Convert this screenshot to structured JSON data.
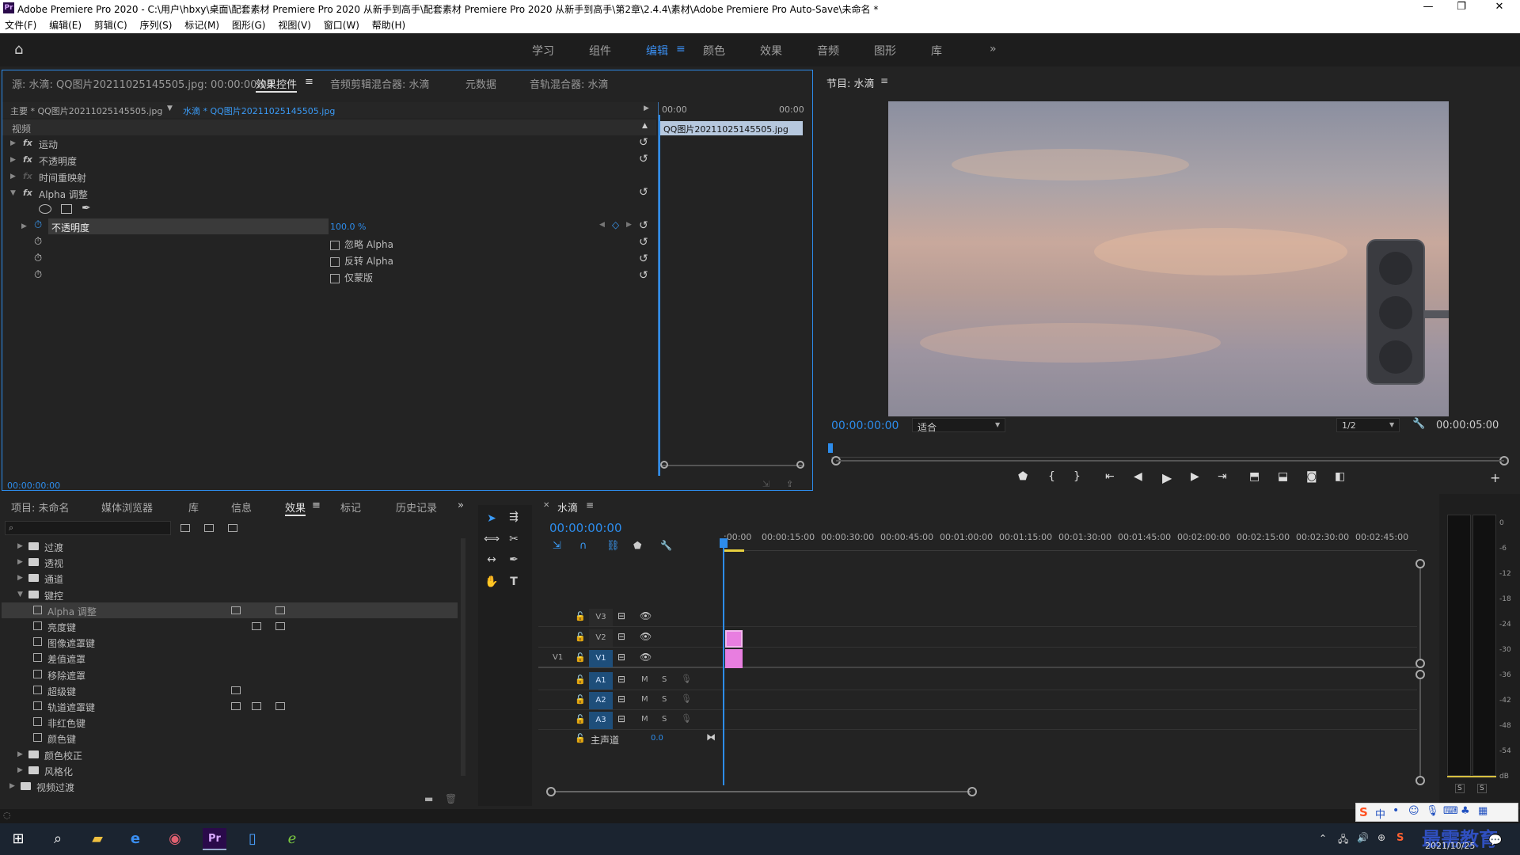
{
  "window": {
    "title": "Adobe Premiere Pro 2020 - C:\\用户\\hbxy\\桌面\\配套素材 Premiere Pro 2020 从新手到高手\\配套素材 Premiere Pro 2020 从新手到高手\\第2章\\2.4.4\\素材\\Adobe Premiere Pro Auto-Save\\未命名 *",
    "app_icon": "Pr",
    "minimize": "—",
    "restore": "❐",
    "close": "✕"
  },
  "menu": [
    "文件(F)",
    "编辑(E)",
    "剪辑(C)",
    "序列(S)",
    "标记(M)",
    "图形(G)",
    "视图(V)",
    "窗口(W)",
    "帮助(H)"
  ],
  "workspaces": {
    "items": [
      "学习",
      "组件",
      "编辑",
      "颜色",
      "效果",
      "音频",
      "图形",
      "库"
    ],
    "active": "编辑",
    "more": "»"
  },
  "effect_controls": {
    "tabs": [
      "源: 水滴: QQ图片20211025145505.jpg: 00:00:00:00",
      "效果控件",
      "音频剪辑混合器: 水滴",
      "元数据",
      "音轨混合器: 水滴"
    ],
    "master_clip": "主要 * QQ图片20211025145505.jpg",
    "seq_clip": "水滴 * QQ图片20211025145505.jpg",
    "mini_start": "00:00",
    "mini_end": "00:00",
    "mini_clip": "QQ图片20211025145505.jpg",
    "section": "视频",
    "fx": [
      {
        "name": "运动"
      },
      {
        "name": "不透明度"
      },
      {
        "name": "时间重映射"
      },
      {
        "name": "Alpha 调整"
      }
    ],
    "opacity_label": "不透明度",
    "opacity_value": "100.0 %",
    "checks": [
      "忽略 Alpha",
      "反转 Alpha",
      "仅蒙版"
    ],
    "timecode": "00:00:00:00"
  },
  "program": {
    "title": "节目: 水滴",
    "timecode": "00:00:00:00",
    "fit": "适合",
    "res": "1/2",
    "duration": "00:00:05:00"
  },
  "project": {
    "tabs": [
      "项目: 未命名",
      "媒体浏览器",
      "库",
      "信息",
      "效果",
      "标记",
      "历史记录"
    ],
    "active_tab": "效果",
    "search_placeholder": "",
    "tree": [
      {
        "label": "过渡",
        "level": 1,
        "type": "folder",
        "open": false
      },
      {
        "label": "透视",
        "level": 1,
        "type": "folder",
        "open": false
      },
      {
        "label": "通道",
        "level": 1,
        "type": "folder",
        "open": false
      },
      {
        "label": "键控",
        "level": 1,
        "type": "folder",
        "open": true
      },
      {
        "label": "Alpha 调整",
        "level": 2,
        "type": "fx",
        "selected": true
      },
      {
        "label": "亮度键",
        "level": 2,
        "type": "fx"
      },
      {
        "label": "图像遮罩键",
        "level": 2,
        "type": "fx"
      },
      {
        "label": "差值遮罩",
        "level": 2,
        "type": "fx"
      },
      {
        "label": "移除遮罩",
        "level": 2,
        "type": "fx"
      },
      {
        "label": "超级键",
        "level": 2,
        "type": "fx"
      },
      {
        "label": "轨道遮罩键",
        "level": 2,
        "type": "fx"
      },
      {
        "label": "非红色键",
        "level": 2,
        "type": "fx"
      },
      {
        "label": "颜色键",
        "level": 2,
        "type": "fx"
      },
      {
        "label": "颜色校正",
        "level": 1,
        "type": "folder",
        "open": false
      },
      {
        "label": "风格化",
        "level": 1,
        "type": "folder",
        "open": false
      },
      {
        "label": "视频过渡",
        "level": 0,
        "type": "folder",
        "open": false
      }
    ]
  },
  "timeline": {
    "title": "水滴",
    "timecode": "00:00:00:00",
    "ruler": [
      ":00:00",
      "00:00:15:00",
      "00:00:30:00",
      "00:00:45:00",
      "00:01:00:00",
      "00:01:15:00",
      "00:01:30:00",
      "00:01:45:00",
      "00:02:00:00",
      "00:02:15:00",
      "00:02:30:00",
      "00:02:45:00"
    ],
    "video_tracks": [
      "V3",
      "V2",
      "V1"
    ],
    "src_v": "V1",
    "audio_tracks": [
      "A1",
      "A2",
      "A3"
    ],
    "master": "主声道",
    "master_val": "0.0",
    "m": "M",
    "s": "S",
    "clip_color": "#e87ee0"
  },
  "meter": {
    "labels": [
      "0",
      "-6",
      "-12",
      "-18",
      "-24",
      "-30",
      "-36",
      "-42",
      "-48",
      "-54",
      "dB"
    ],
    "s1": "S",
    "s2": "S"
  },
  "taskbar": {
    "date": "2021/10/25",
    "watermark": "最需教育",
    "ime": "中"
  }
}
